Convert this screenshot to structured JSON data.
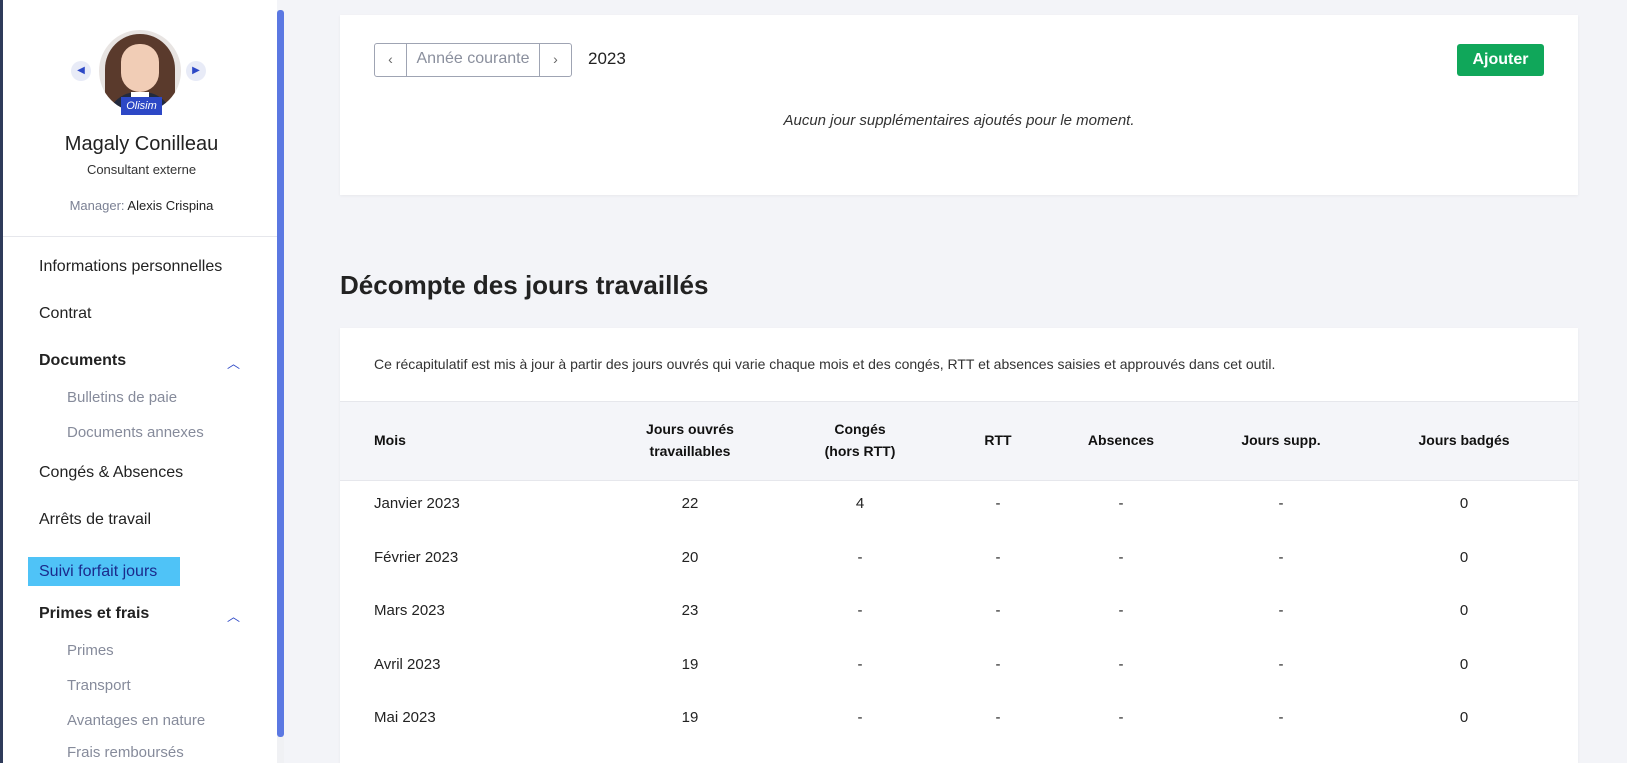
{
  "profile": {
    "name": "Magaly Conilleau",
    "role": "Consultant externe",
    "manager_label": "Manager:",
    "manager_name": "Alexis Crispina",
    "badge": "Olisim"
  },
  "nav": {
    "items": [
      {
        "label": "Informations personnelles"
      },
      {
        "label": "Contrat"
      },
      {
        "label": "Documents"
      },
      {
        "label": "Bulletins de paie"
      },
      {
        "label": "Documents annexes"
      },
      {
        "label": "Congés & Absences"
      },
      {
        "label": "Arrêts de travail"
      },
      {
        "label": "Suivi forfait jours"
      },
      {
        "label": "Primes et frais"
      },
      {
        "label": "Primes"
      },
      {
        "label": "Transport"
      },
      {
        "label": "Avantages en nature"
      },
      {
        "label": "Frais remboursés"
      }
    ]
  },
  "year_panel": {
    "prev": "‹",
    "current_label": "Année courante",
    "next": "›",
    "year": "2023",
    "add_label": "Ajouter",
    "empty_message": "Aucun jour supplémentaires ajoutés pour le moment."
  },
  "decompte": {
    "title": "Décompte des jours travaillés",
    "info": "Ce récapitulatif est mis à jour à partir des jours ouvrés qui varie chaque mois et des congés, RTT et absences saisies et approuvés dans cet outil.",
    "columns": [
      {
        "line1": "Mois",
        "line2": ""
      },
      {
        "line1": "Jours ouvrés",
        "line2": "travaillables"
      },
      {
        "line1": "Congés",
        "line2": "(hors RTT)"
      },
      {
        "line1": "RTT",
        "line2": ""
      },
      {
        "line1": "Absences",
        "line2": ""
      },
      {
        "line1": "Jours supp.",
        "line2": ""
      },
      {
        "line1": "Jours badgés",
        "line2": ""
      }
    ],
    "rows": [
      [
        "Janvier 2023",
        "22",
        "4",
        "-",
        "-",
        "-",
        "0"
      ],
      [
        "Février 2023",
        "20",
        "-",
        "-",
        "-",
        "-",
        "0"
      ],
      [
        "Mars 2023",
        "23",
        "-",
        "-",
        "-",
        "-",
        "0"
      ],
      [
        "Avril 2023",
        "19",
        "-",
        "-",
        "-",
        "-",
        "0"
      ],
      [
        "Mai 2023",
        "19",
        "-",
        "-",
        "-",
        "-",
        "0"
      ]
    ]
  },
  "colors": {
    "accent": "#2d48c6",
    "active_bg": "#4fc3f7",
    "add_button": "#10a75a"
  },
  "icons": {
    "prev_profile": "caret-left-icon",
    "next_profile": "caret-right-icon",
    "chevron_up": "chevron-up-icon"
  }
}
